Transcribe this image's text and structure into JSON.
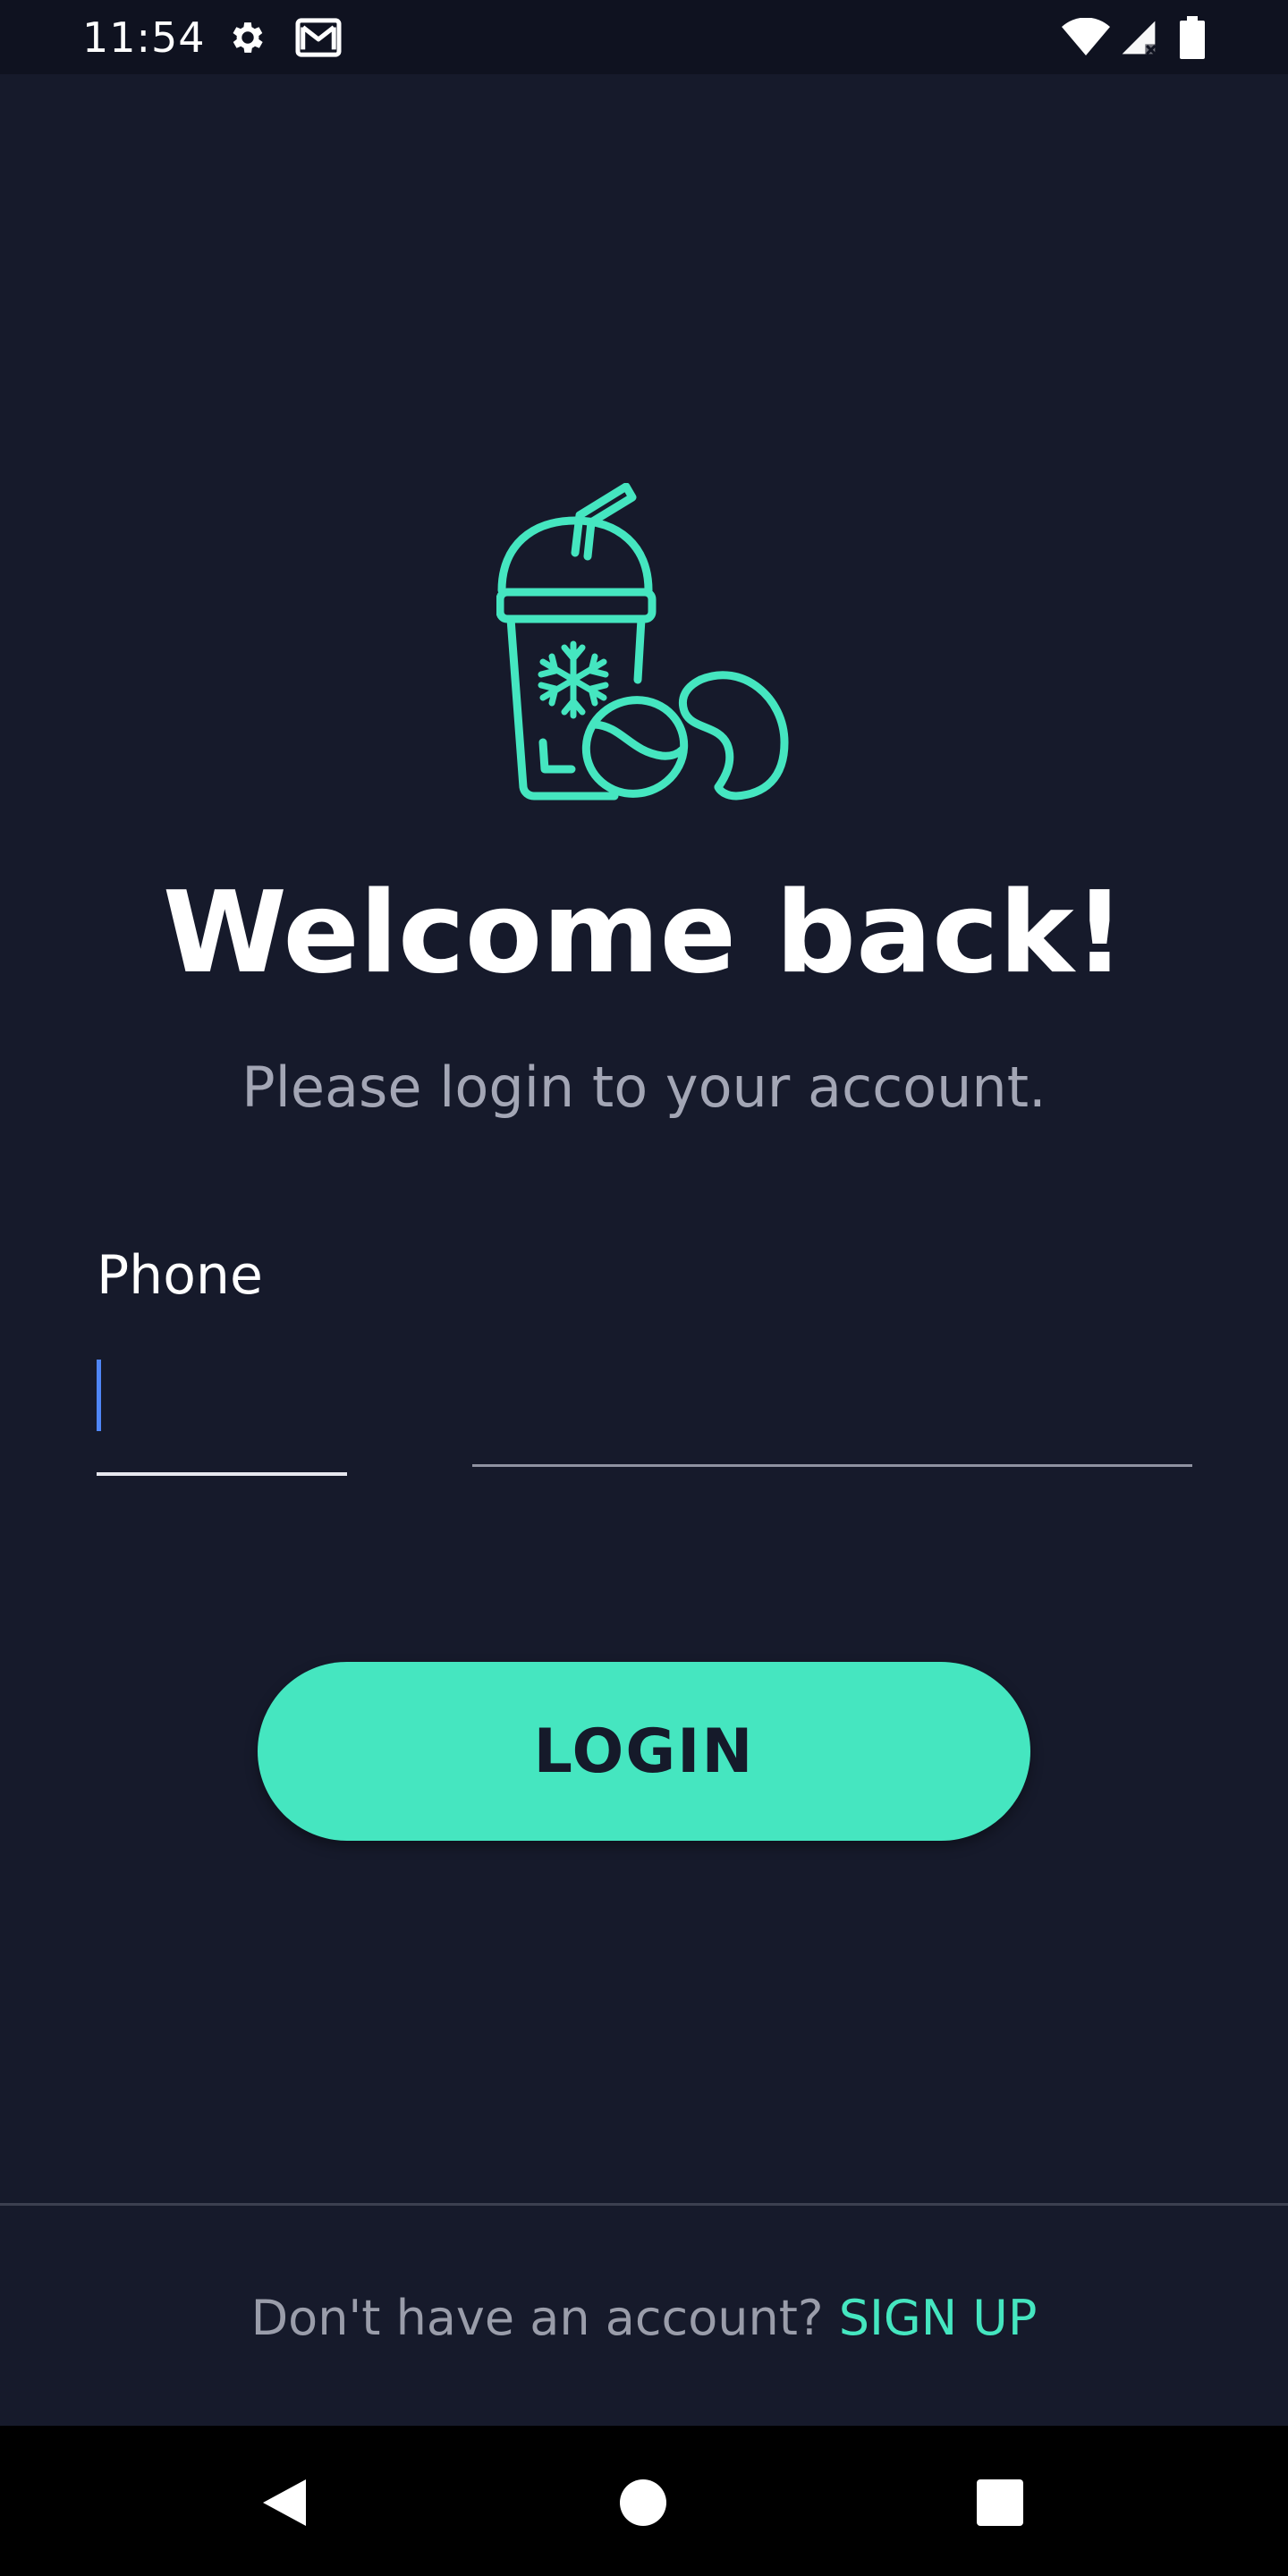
{
  "status_bar": {
    "time": "11:54",
    "icons": [
      "settings-icon",
      "gmail-icon",
      "wifi-icon",
      "signal-icon",
      "battery-icon"
    ]
  },
  "logo": {
    "icon": "iced-coffee-cup-with-coffee-beans-icon",
    "color": "#45e6c0"
  },
  "welcome": {
    "title": "Welcome back!",
    "subtitle": "Please login to your account."
  },
  "form": {
    "phone_label": "Phone",
    "phone_value": ""
  },
  "login_button": {
    "label": "LOGIN"
  },
  "footer": {
    "prompt": "Don't have an account? ",
    "signup_label": "SIGN UP"
  },
  "nav_bar": {
    "buttons": [
      "back-icon",
      "home-icon",
      "recents-icon"
    ]
  },
  "colors": {
    "background": "#161a2b",
    "accent": "#45e6c0",
    "cursor": "#4f86f7",
    "subtitle": "#a3a6b5"
  }
}
